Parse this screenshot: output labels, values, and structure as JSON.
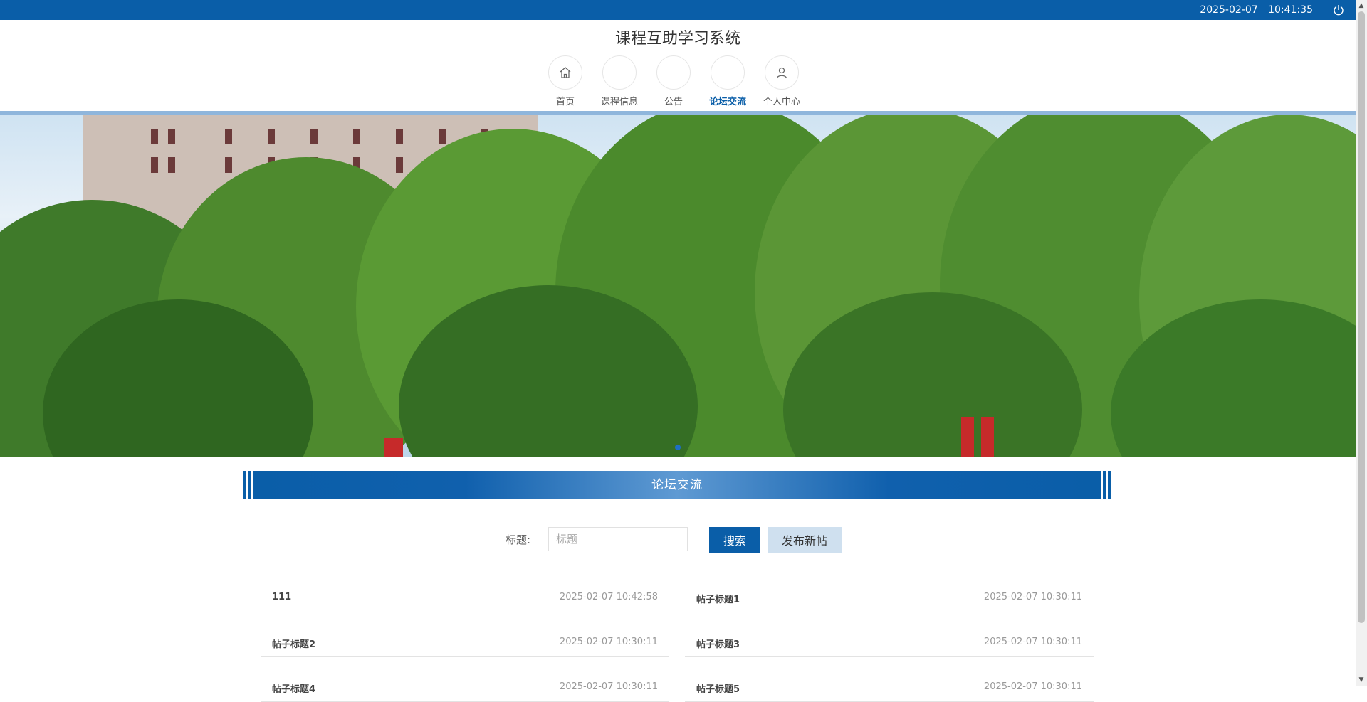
{
  "topbar": {
    "date": "2025-02-07",
    "time": "10:41:35",
    "bg_color": "#0a5ea8",
    "logout_icon": "power-icon"
  },
  "site_title": "课程互助学习系统",
  "nav": {
    "items": [
      {
        "label": "首页",
        "icon": "home-icon",
        "active": false
      },
      {
        "label": "课程信息",
        "icon": "",
        "active": false
      },
      {
        "label": "公告",
        "icon": "",
        "active": false
      },
      {
        "label": "论坛交流",
        "icon": "",
        "active": true
      },
      {
        "label": "个人中心",
        "icon": "user-icon",
        "active": false
      }
    ],
    "active_color": "#0a5ea8"
  },
  "banner": {
    "slides_indicator_active": 0
  },
  "section": {
    "title": "论坛交流"
  },
  "search": {
    "label": "标题:",
    "placeholder": "标题",
    "search_button": "搜索",
    "new_post_button": "发布新帖"
  },
  "posts": [
    {
      "title": "111",
      "time": "2025-02-07 10:42:58"
    },
    {
      "title": "帖子标题1",
      "time": "2025-02-07 10:30:11"
    },
    {
      "title": "帖子标题2",
      "time": "2025-02-07 10:30:11"
    },
    {
      "title": "帖子标题3",
      "time": "2025-02-07 10:30:11"
    },
    {
      "title": "帖子标题4",
      "time": "2025-02-07 10:30:11"
    },
    {
      "title": "帖子标题5",
      "time": "2025-02-07 10:30:11"
    }
  ]
}
